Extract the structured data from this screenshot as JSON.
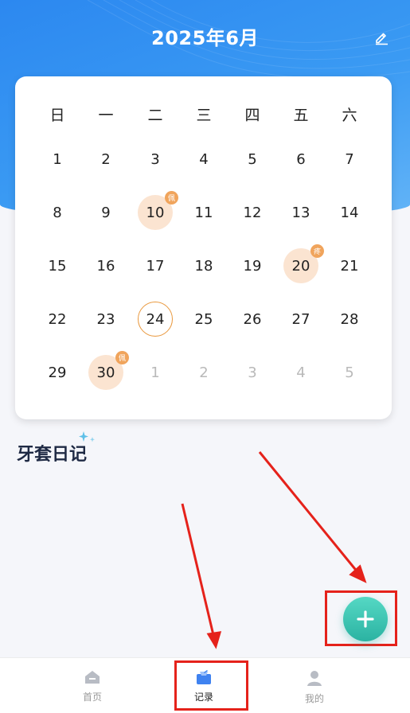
{
  "header": {
    "title": "2025年6月",
    "edit_icon": "pencil-icon"
  },
  "calendar": {
    "weekdays": [
      "日",
      "一",
      "二",
      "三",
      "四",
      "五",
      "六"
    ],
    "weeks": [
      [
        {
          "d": "1"
        },
        {
          "d": "2"
        },
        {
          "d": "3"
        },
        {
          "d": "4"
        },
        {
          "d": "5"
        },
        {
          "d": "6"
        },
        {
          "d": "7"
        }
      ],
      [
        {
          "d": "8"
        },
        {
          "d": "9"
        },
        {
          "d": "10",
          "marked": true,
          "badge": "佩"
        },
        {
          "d": "11"
        },
        {
          "d": "12"
        },
        {
          "d": "13"
        },
        {
          "d": "14"
        }
      ],
      [
        {
          "d": "15"
        },
        {
          "d": "16"
        },
        {
          "d": "17"
        },
        {
          "d": "18"
        },
        {
          "d": "19"
        },
        {
          "d": "20",
          "marked": true,
          "badge": "疼"
        },
        {
          "d": "21"
        }
      ],
      [
        {
          "d": "22"
        },
        {
          "d": "23"
        },
        {
          "d": "24",
          "today": true
        },
        {
          "d": "25"
        },
        {
          "d": "26"
        },
        {
          "d": "27"
        },
        {
          "d": "28"
        }
      ],
      [
        {
          "d": "29"
        },
        {
          "d": "30",
          "marked": true,
          "badge": "佩"
        },
        {
          "d": "1",
          "muted": true
        },
        {
          "d": "2",
          "muted": true
        },
        {
          "d": "3",
          "muted": true
        },
        {
          "d": "4",
          "muted": true
        },
        {
          "d": "5",
          "muted": true
        }
      ]
    ],
    "colors": {
      "marked_bg": "#fbe4d1",
      "badge": "#f0a45c",
      "today_ring": "#e9973b"
    }
  },
  "diary": {
    "title": "牙套日记"
  },
  "fab": {
    "icon": "plus-icon",
    "color": "#2bb3a2"
  },
  "nav": {
    "items": [
      {
        "label": "首页",
        "icon": "home-icon",
        "active": false
      },
      {
        "label": "记录",
        "icon": "record-icon",
        "active": true
      },
      {
        "label": "我的",
        "icon": "user-icon",
        "active": false
      }
    ]
  },
  "annotation": {
    "color": "#e5221b"
  }
}
